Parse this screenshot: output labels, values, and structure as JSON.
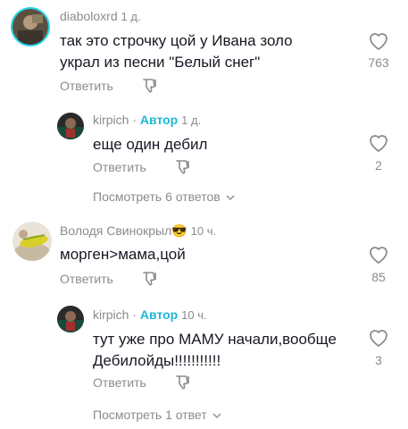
{
  "comments": [
    {
      "username": "diaboloxrd",
      "time": "1 д.",
      "text_lines": [
        "так это строчку цой у Ивана золо",
        "украл из песни \"Белый снег\""
      ],
      "reply_label": "Ответить",
      "like_count": "763"
    },
    {
      "username": "kirpich",
      "author_label": "Автор",
      "time": "1 д.",
      "text_lines": [
        "еще один дебил"
      ],
      "reply_label": "Ответить",
      "like_count": "2",
      "view_replies": "Посмотреть 6 ответов"
    },
    {
      "username": "Володя Свинокрыл😎",
      "time": "10 ч.",
      "text_lines": [
        "морген>мама,цой"
      ],
      "reply_label": "Ответить",
      "like_count": "85"
    },
    {
      "username": "kirpich",
      "author_label": "Автор",
      "time": "10 ч.",
      "text_lines": [
        "тут уже про МАМУ начали,вообще",
        "Дебилойды!!!!!!!!!!!"
      ],
      "reply_label": "Ответить",
      "like_count": "3",
      "view_replies": "Посмотреть 1 ответ"
    }
  ],
  "colors": {
    "accent": "#20d5ec",
    "author": "#20b8d5",
    "muted": "#8a8b91",
    "text": "#161823"
  },
  "icons": {
    "like": "heart-outline-icon",
    "dislike": "thumbs-down-icon",
    "chevron": "chevron-down-icon"
  }
}
